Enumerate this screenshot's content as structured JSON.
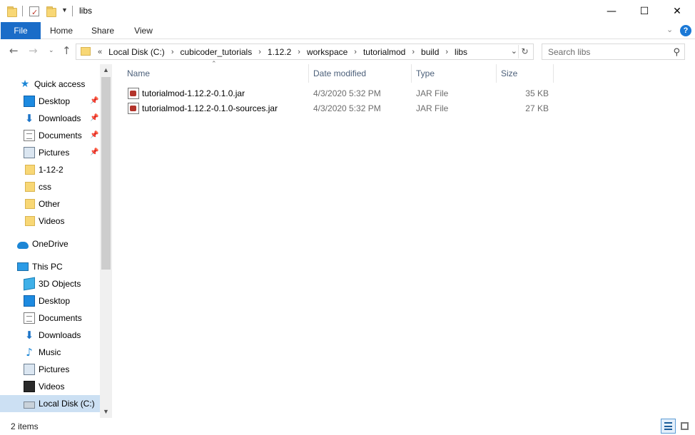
{
  "window": {
    "title": "libs",
    "minimize_glyph": "—",
    "maximize_glyph": "☐",
    "close_glyph": "✕"
  },
  "ribbon": {
    "tabs": [
      "File",
      "Home",
      "Share",
      "View"
    ],
    "expand_glyph": "⌄",
    "help_glyph": "?"
  },
  "address": {
    "overflow_glyph": "«",
    "crumbs": [
      "Local Disk (C:)",
      "cubicoder_tutorials",
      "1.12.2",
      "workspace",
      "tutorialmod",
      "build",
      "libs"
    ],
    "separator": "›"
  },
  "search": {
    "placeholder": "Search libs"
  },
  "nav": {
    "quick_access": {
      "label": "Quick access",
      "items": [
        {
          "label": "Desktop",
          "icon": "desktop-icon",
          "pinned": true
        },
        {
          "label": "Downloads",
          "icon": "downloads-icon",
          "pinned": true
        },
        {
          "label": "Documents",
          "icon": "documents-icon",
          "pinned": true
        },
        {
          "label": "Pictures",
          "icon": "pictures-icon",
          "pinned": true
        },
        {
          "label": "1-12-2",
          "icon": "folder-icon",
          "pinned": false
        },
        {
          "label": "css",
          "icon": "folder-icon",
          "pinned": false
        },
        {
          "label": "Other",
          "icon": "folder-icon",
          "pinned": false
        },
        {
          "label": "Videos",
          "icon": "folder-icon",
          "pinned": false
        }
      ]
    },
    "onedrive": {
      "label": "OneDrive"
    },
    "this_pc": {
      "label": "This PC",
      "items": [
        {
          "label": "3D Objects",
          "icon": "3d-objects-icon"
        },
        {
          "label": "Desktop",
          "icon": "desktop-icon"
        },
        {
          "label": "Documents",
          "icon": "documents-icon"
        },
        {
          "label": "Downloads",
          "icon": "downloads-icon"
        },
        {
          "label": "Music",
          "icon": "music-icon"
        },
        {
          "label": "Pictures",
          "icon": "pictures-icon"
        },
        {
          "label": "Videos",
          "icon": "videos-icon"
        },
        {
          "label": "Local Disk (C:)",
          "icon": "disk-icon",
          "selected": true
        }
      ]
    }
  },
  "columns": [
    "Name",
    "Date modified",
    "Type",
    "Size"
  ],
  "files": [
    {
      "name": "tutorialmod-1.12.2-0.1.0.jar",
      "date": "4/3/2020 5:32 PM",
      "type": "JAR File",
      "size": "35 KB"
    },
    {
      "name": "tutorialmod-1.12.2-0.1.0-sources.jar",
      "date": "4/3/2020 5:32 PM",
      "type": "JAR File",
      "size": "27 KB"
    }
  ],
  "status": {
    "item_count": "2 items"
  },
  "colors": {
    "accent": "#1a6cc8",
    "selected_bg": "#cce0f3",
    "folder": "#f8d775"
  }
}
